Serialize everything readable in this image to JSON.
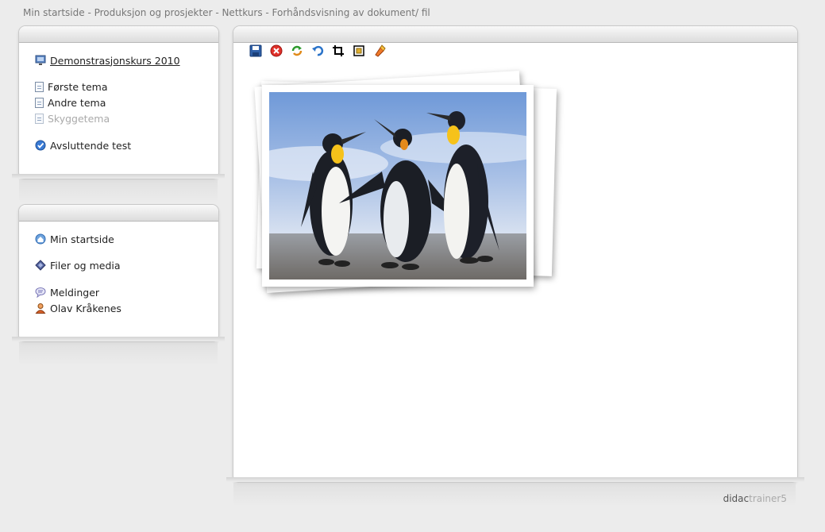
{
  "breadcrumb": "Min startside - Produksjon og prosjekter - Nettkurs - Forhåndsvisning av dokument/ fil",
  "course_panel": {
    "course": "Demonstrasjonskurs 2010",
    "topics": [
      "Første tema",
      "Andre tema",
      "Skyggetema"
    ],
    "test": "Avsluttende test"
  },
  "user_panel": {
    "home": "Min startside",
    "files": "Filer og media",
    "messages": "Meldinger",
    "user": "Olav Kråkenes"
  },
  "toolbar": {
    "tools": [
      "save-icon",
      "cancel-icon",
      "rotate-icon",
      "undo-icon",
      "crop-icon",
      "resize-icon",
      "paint-icon"
    ]
  },
  "footer": {
    "brand_a": "didac",
    "brand_b": "trainer5"
  },
  "colors": {
    "background": "#ececec",
    "header": "#dcdcdc",
    "link": "#222222"
  }
}
